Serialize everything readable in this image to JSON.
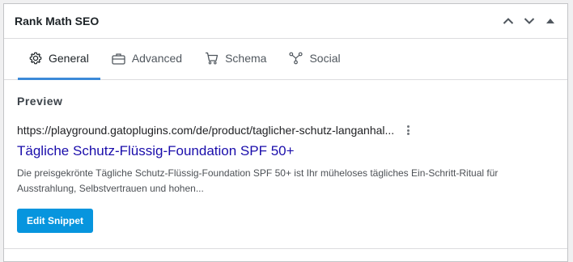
{
  "metabox": {
    "title": "Rank Math SEO",
    "controls": [
      "move-up",
      "move-down",
      "toggle"
    ]
  },
  "tabs": [
    {
      "label": "General",
      "icon": "gear-icon",
      "active": true
    },
    {
      "label": "Advanced",
      "icon": "briefcase-icon",
      "active": false
    },
    {
      "label": "Schema",
      "icon": "cart-icon",
      "active": false
    },
    {
      "label": "Social",
      "icon": "share-icon",
      "active": false
    }
  ],
  "preview": {
    "section_label": "Preview",
    "url": "https://playground.gatoplugins.com/de/product/taglicher-schutz-langanhal...",
    "title": "Tägliche Schutz-Flüssig-Foundation SPF 50+",
    "description": "Die preisgekrönte Tägliche Schutz-Flüssig-Foundation SPF 50+ ist Ihr müheloses tägliches Ein-Schritt-Ritual für Ausstrahlung, Selbstvertrauen und hohen...",
    "edit_button": "Edit Snippet"
  },
  "colors": {
    "active_tab_underline": "#3c8ad8",
    "link": "#1a0dab",
    "button": "#0795de"
  }
}
